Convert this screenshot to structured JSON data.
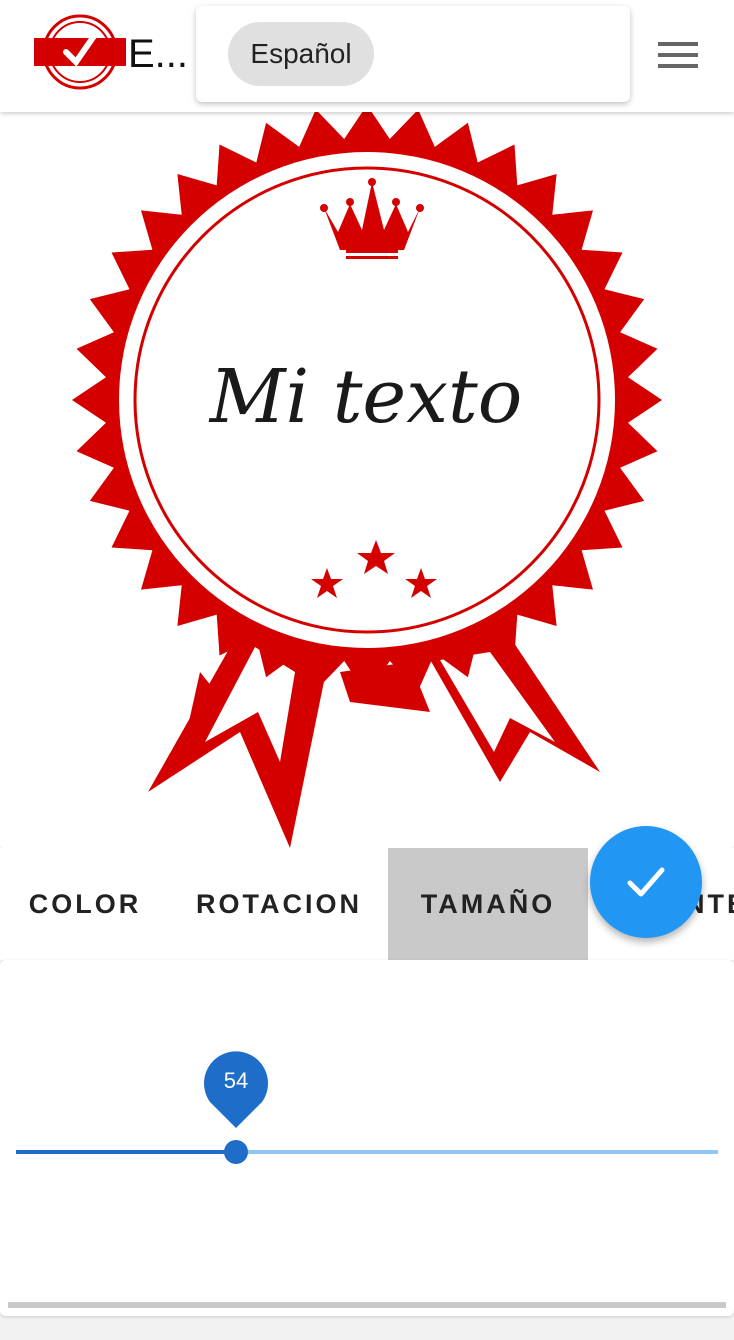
{
  "app": {
    "title": "E..."
  },
  "language": {
    "selected": "Español"
  },
  "badge": {
    "text": "Mi texto"
  },
  "tabs": [
    {
      "label": "COLOR"
    },
    {
      "label": "ROTACION"
    },
    {
      "label": "TAMAÑO",
      "selected": true
    },
    {
      "label": "FUENTE"
    }
  ],
  "size_slider": {
    "value": "54",
    "fraction": 0.31
  },
  "colors": {
    "accent": "#2196f3",
    "badge_red": "#d40000",
    "selected_tab": "#c9c9c9"
  },
  "icons": {
    "logo": "approved-stamp-icon",
    "menu": "menu-icon",
    "fab": "check-icon"
  }
}
